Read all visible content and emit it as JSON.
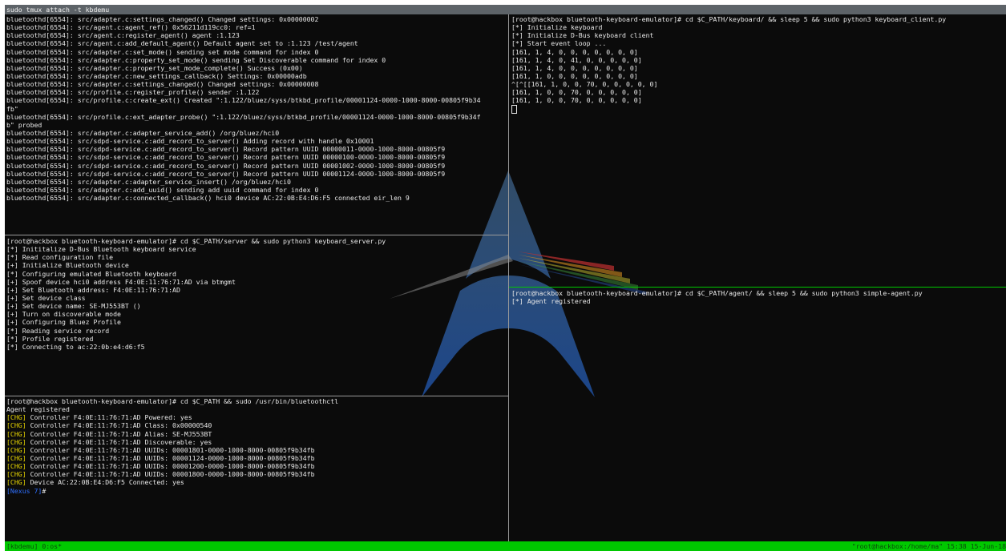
{
  "window": {
    "title": "sudo tmux attach -t kbdemu"
  },
  "colors": {
    "chg": "#e6d400",
    "prompt_highlight": "#2f6fff",
    "status_bar": "#00c800",
    "active_border": "#00c800"
  },
  "panes": {
    "bluetoothd_log": {
      "lines": [
        "bluetoothd[6554]: src/adapter.c:settings_changed() Changed settings: 0x00000002",
        "bluetoothd[6554]: src/agent.c:agent_ref() 0x56211d119cc0: ref=1",
        "bluetoothd[6554]: src/agent.c:register_agent() agent :1.123",
        "bluetoothd[6554]: src/agent.c:add_default_agent() Default agent set to :1.123 /test/agent",
        "bluetoothd[6554]: src/adapter.c:set_mode() sending set mode command for index 0",
        "bluetoothd[6554]: src/adapter.c:property_set_mode() sending Set Discoverable command for index 0",
        "bluetoothd[6554]: src/adapter.c:property_set_mode_complete() Success (0x00)",
        "bluetoothd[6554]: src/adapter.c:new_settings_callback() Settings: 0x00000adb",
        "bluetoothd[6554]: src/adapter.c:settings_changed() Changed settings: 0x00000008",
        "bluetoothd[6554]: src/profile.c:register_profile() sender :1.122",
        "bluetoothd[6554]: src/profile.c:create_ext() Created \":1.122/bluez/syss/btkbd_profile/00001124-0000-1000-8000-00805f9b34",
        "fb\"",
        "bluetoothd[6554]: src/profile.c:ext_adapter_probe() \":1.122/bluez/syss/btkbd_profile/00001124-0000-1000-8000-00805f9b34f",
        "b\" probed",
        "bluetoothd[6554]: src/adapter.c:adapter_service_add() /org/bluez/hci0",
        "bluetoothd[6554]: src/sdpd-service.c:add_record_to_server() Adding record with handle 0x10001",
        "bluetoothd[6554]: src/sdpd-service.c:add_record_to_server() Record pattern UUID 00000011-0000-1000-8000-00805f9",
        "bluetoothd[6554]: src/sdpd-service.c:add_record_to_server() Record pattern UUID 00000100-0000-1000-8000-00805f9",
        "bluetoothd[6554]: src/sdpd-service.c:add_record_to_server() Record pattern UUID 00001002-0000-1000-8000-00805f9",
        "bluetoothd[6554]: src/sdpd-service.c:add_record_to_server() Record pattern UUID 00001124-0000-1000-8000-00805f9",
        "bluetoothd[6554]: src/adapter.c:adapter_service_insert() /org/bluez/hci0",
        "bluetoothd[6554]: src/adapter.c:add_uuid() sending add uuid command for index 0",
        "bluetoothd[6554]: src/adapter.c:connected_callback() hci0 device AC:22:0B:E4:D6:F5 connected eir_len 9"
      ]
    },
    "server": {
      "lines": [
        "[root@hackbox bluetooth-keyboard-emulator]# cd $C_PATH/server && sudo python3 keyboard_server.py",
        "[*] Inititalize D-Bus Bluetooth keyboard service",
        "[*] Read configuration file",
        "[+] Initialize Bluetooth device",
        "[*] Configuring emulated Bluetooth keyboard",
        "[+] Spoof device hci0 address F4:0E:11:76:71:AD via btmgmt",
        "[+] Set Bluetooth address: F4:0E:11:76:71:AD",
        "[+] Set device class",
        "[+] Set device name: SE-MJ553BT ()",
        "[+] Turn on discoverable mode",
        "[+] Configuring Bluez Profile",
        "[*] Reading service record",
        "[*] Profile registered",
        "[*] Connecting to ac:22:0b:e4:d6:f5"
      ]
    },
    "bluetoothctl": {
      "command": "[root@hackbox bluetooth-keyboard-emulator]# cd $C_PATH && sudo /usr/bin/bluetoothctl",
      "agent_line": "Agent registered",
      "chg_tag": "[CHG]",
      "chg_lines": [
        " Controller F4:0E:11:76:71:AD Powered: yes",
        " Controller F4:0E:11:76:71:AD Class: 0x00000540",
        " Controller F4:0E:11:76:71:AD Alias: SE-MJ553BT",
        " Controller F4:0E:11:76:71:AD Discoverable: yes",
        " Controller F4:0E:11:76:71:AD UUIDs: 00001801-0000-1000-8000-00805f9b34fb",
        " Controller F4:0E:11:76:71:AD UUIDs: 00001124-0000-1000-8000-00805f9b34fb",
        " Controller F4:0E:11:76:71:AD UUIDs: 00001200-0000-1000-8000-00805f9b34fb",
        " Controller F4:0E:11:76:71:AD UUIDs: 00001800-0000-1000-8000-00805f9b34fb",
        " Device AC:22:0B:E4:D6:F5 Connected: yes"
      ],
      "prompt_device": "[Nexus 7]",
      "prompt_suffix": "#"
    },
    "keyboard_client": {
      "lines": [
        "[root@hackbox bluetooth-keyboard-emulator]# cd $C_PATH/keyboard/ && sleep 5 && sudo python3 keyboard_client.py",
        "[*] Initialize keyboard",
        "[*] Initialize D-Bus keyboard client",
        "[*] Start event loop ...",
        "[161, 1, 4, 0, 0, 0, 0, 0, 0, 0]",
        "[161, 1, 4, 0, 41, 0, 0, 0, 0, 0]",
        "[161, 1, 4, 0, 0, 0, 0, 0, 0, 0]",
        "[161, 1, 0, 0, 0, 0, 0, 0, 0, 0]",
        "^[^[[161, 1, 0, 0, 70, 0, 0, 0, 0, 0]",
        "[161, 1, 0, 0, 70, 0, 0, 0, 0, 0]",
        "[161, 1, 0, 0, 70, 0, 0, 0, 0, 0]"
      ]
    },
    "agent": {
      "lines": [
        "[root@hackbox bluetooth-keyboard-emulator]# cd $C_PATH/agent/ && sleep 5 && sudo python3 simple-agent.py",
        "[*] Agent registered"
      ]
    }
  },
  "status_bar": {
    "left": "[kbdemu] 0:os*",
    "right": "\"root@hackbox:/home/ma\" 15:38 15-Jun-18"
  }
}
